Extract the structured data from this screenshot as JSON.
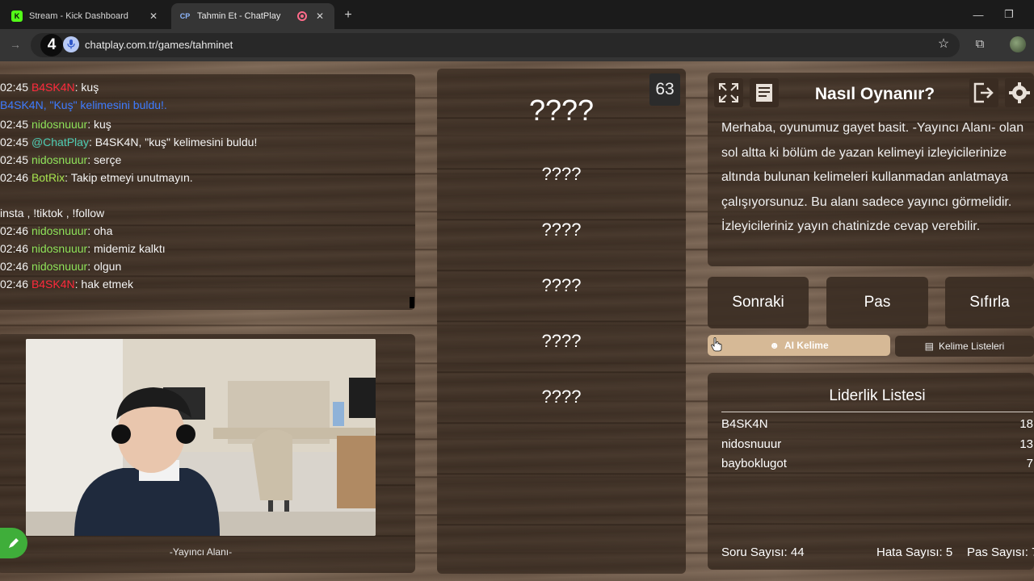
{
  "browser": {
    "tabs": [
      {
        "title": "Stream - Kick Dashboard",
        "favicon": "kick-logo"
      },
      {
        "title": "Tahmin Et - ChatPlay",
        "favicon": "CP"
      }
    ],
    "url": "chatplay.com.tr/games/tahminet",
    "badge_number": "4"
  },
  "chat": {
    "messages": [
      {
        "time": "02:45",
        "user": "B4SK4N",
        "sep": ": ",
        "text": "kuş"
      },
      {
        "time": "",
        "user": "",
        "sep": "",
        "text": "B4SK4N, \"Kuş\" kelimesini buldu!."
      },
      {
        "time": "02:45",
        "user": "nidosnuuur",
        "sep": ": ",
        "text": "kuş"
      },
      {
        "time": "02:45",
        "user": "@ChatPlay",
        "sep": ": ",
        "text": "B4SK4N, \"kuş\" kelimesini buldu!"
      },
      {
        "time": "02:45",
        "user": "nidosnuuur",
        "sep": ": ",
        "text": "serçe"
      },
      {
        "time": "02:46",
        "user": "BotRix",
        "sep": ": ",
        "text": "Takip etmeyi unutmayın."
      },
      {
        "time": "",
        "user": "",
        "sep": "",
        "text": "insta , !tiktok , !follow"
      },
      {
        "time": "02:46",
        "user": "nidosnuuur",
        "sep": ": ",
        "text": "oha"
      },
      {
        "time": "02:46",
        "user": "nidosnuuur",
        "sep": ": ",
        "text": "midemiz kalktı"
      },
      {
        "time": "02:46",
        "user": "nidosnuuur",
        "sep": ": ",
        "text": "olgun"
      },
      {
        "time": "02:46",
        "user": "B4SK4N",
        "sep": ": ",
        "text": "hak etmek"
      }
    ]
  },
  "webcam": {
    "label": "-Yayıncı Alanı-"
  },
  "game": {
    "counter": "63",
    "words": [
      "????",
      "????",
      "????",
      "????",
      "????",
      "????"
    ]
  },
  "howto": {
    "title": "Nasıl Oynanır?",
    "text": "Merhaba, oyunumuz gayet basit. -Yayıncı Alanı- olan sol altta ki bölüm de yazan kelimeyi izleyicilerinize altında bulunan kelimeleri kullanmadan anlatmaya çalışıyorsunuz. Bu alanı sadece yayıncı görmelidir. İzleyicileriniz yayın chatinizde cevap verebilir."
  },
  "controls": {
    "next": "Sonraki",
    "pass": "Pas",
    "reset": "Sıfırla",
    "ai_word": "AI Kelime",
    "word_lists": "Kelime Listeleri"
  },
  "leaderboard": {
    "title": "Liderlik Listesi",
    "rows": [
      {
        "name": "B4SK4N",
        "score": "18"
      },
      {
        "name": "nidosnuuur",
        "score": "13"
      },
      {
        "name": "bayboklugot",
        "score": "7"
      }
    ],
    "stats": {
      "questions": "Soru Sayısı: 44",
      "errors": "Hata Sayısı: 5",
      "passes": "Pas Sayısı: 7"
    }
  },
  "colors": {
    "kick_green": "#53fc18",
    "red_user": "#ff2a3c",
    "green_user": "#8fe35a",
    "chatplay_user": "#4ecdb4",
    "ai_button": "#d6b996"
  }
}
